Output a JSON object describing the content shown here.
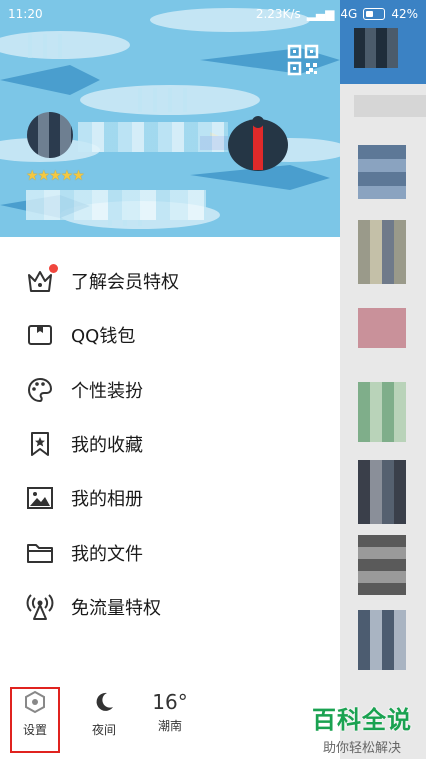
{
  "status_bar": {
    "time": "11:20",
    "net_speed": "2.23K/s",
    "network": "4G",
    "battery": "42%"
  },
  "profile": {
    "stars": "★★★★★"
  },
  "menu": {
    "items": [
      {
        "label": "了解会员特权",
        "icon": "crown-icon"
      },
      {
        "label": "QQ钱包",
        "icon": "wallet-icon"
      },
      {
        "label": "个性装扮",
        "icon": "palette-icon"
      },
      {
        "label": "我的收藏",
        "icon": "bookmark-star-icon"
      },
      {
        "label": "我的相册",
        "icon": "photo-icon"
      },
      {
        "label": "我的文件",
        "icon": "folder-icon"
      },
      {
        "label": "免流量特权",
        "icon": "antenna-icon"
      }
    ]
  },
  "bottom_bar": {
    "settings": "设置",
    "night": "夜间",
    "temperature": "16°",
    "city": "潮南"
  },
  "watermark": {
    "title": "百科全说",
    "subtitle": "助你轻松解决"
  },
  "colors": {
    "banner_blue": "#7bc5e6",
    "accent_red": "#e0231f",
    "badge_red": "#f0463d",
    "watermark_green": "#1aa251"
  }
}
